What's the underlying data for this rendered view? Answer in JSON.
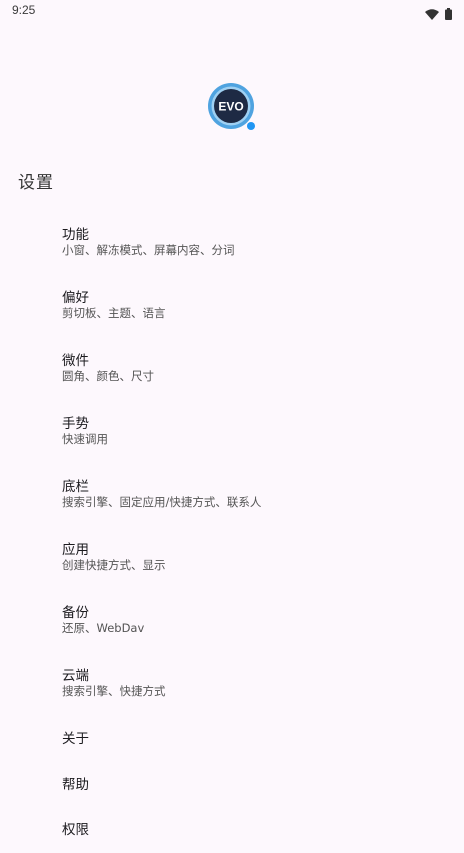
{
  "status_bar": {
    "time": "9:25"
  },
  "logo": {
    "text": "EVO"
  },
  "page": {
    "title": "设置"
  },
  "settings": [
    {
      "title": "功能",
      "subtitle": "小窗、解冻模式、屏幕内容、分词"
    },
    {
      "title": "偏好",
      "subtitle": "剪切板、主题、语言"
    },
    {
      "title": "微件",
      "subtitle": "圆角、颜色、尺寸"
    },
    {
      "title": "手势",
      "subtitle": "快速调用"
    },
    {
      "title": "底栏",
      "subtitle": "搜索引擎、固定应用/快捷方式、联系人"
    },
    {
      "title": "应用",
      "subtitle": "创建快捷方式、显示"
    },
    {
      "title": "备份",
      "subtitle": "还原、WebDav"
    },
    {
      "title": "云端",
      "subtitle": "搜索引擎、快捷方式"
    },
    {
      "title": "关于"
    },
    {
      "title": "帮助"
    },
    {
      "title": "权限"
    }
  ],
  "colors": {
    "background": "#fdf8fd",
    "logo_ring": "#4fa3e0",
    "logo_inner": "#1e2a44",
    "logo_dot": "#2196f3"
  }
}
